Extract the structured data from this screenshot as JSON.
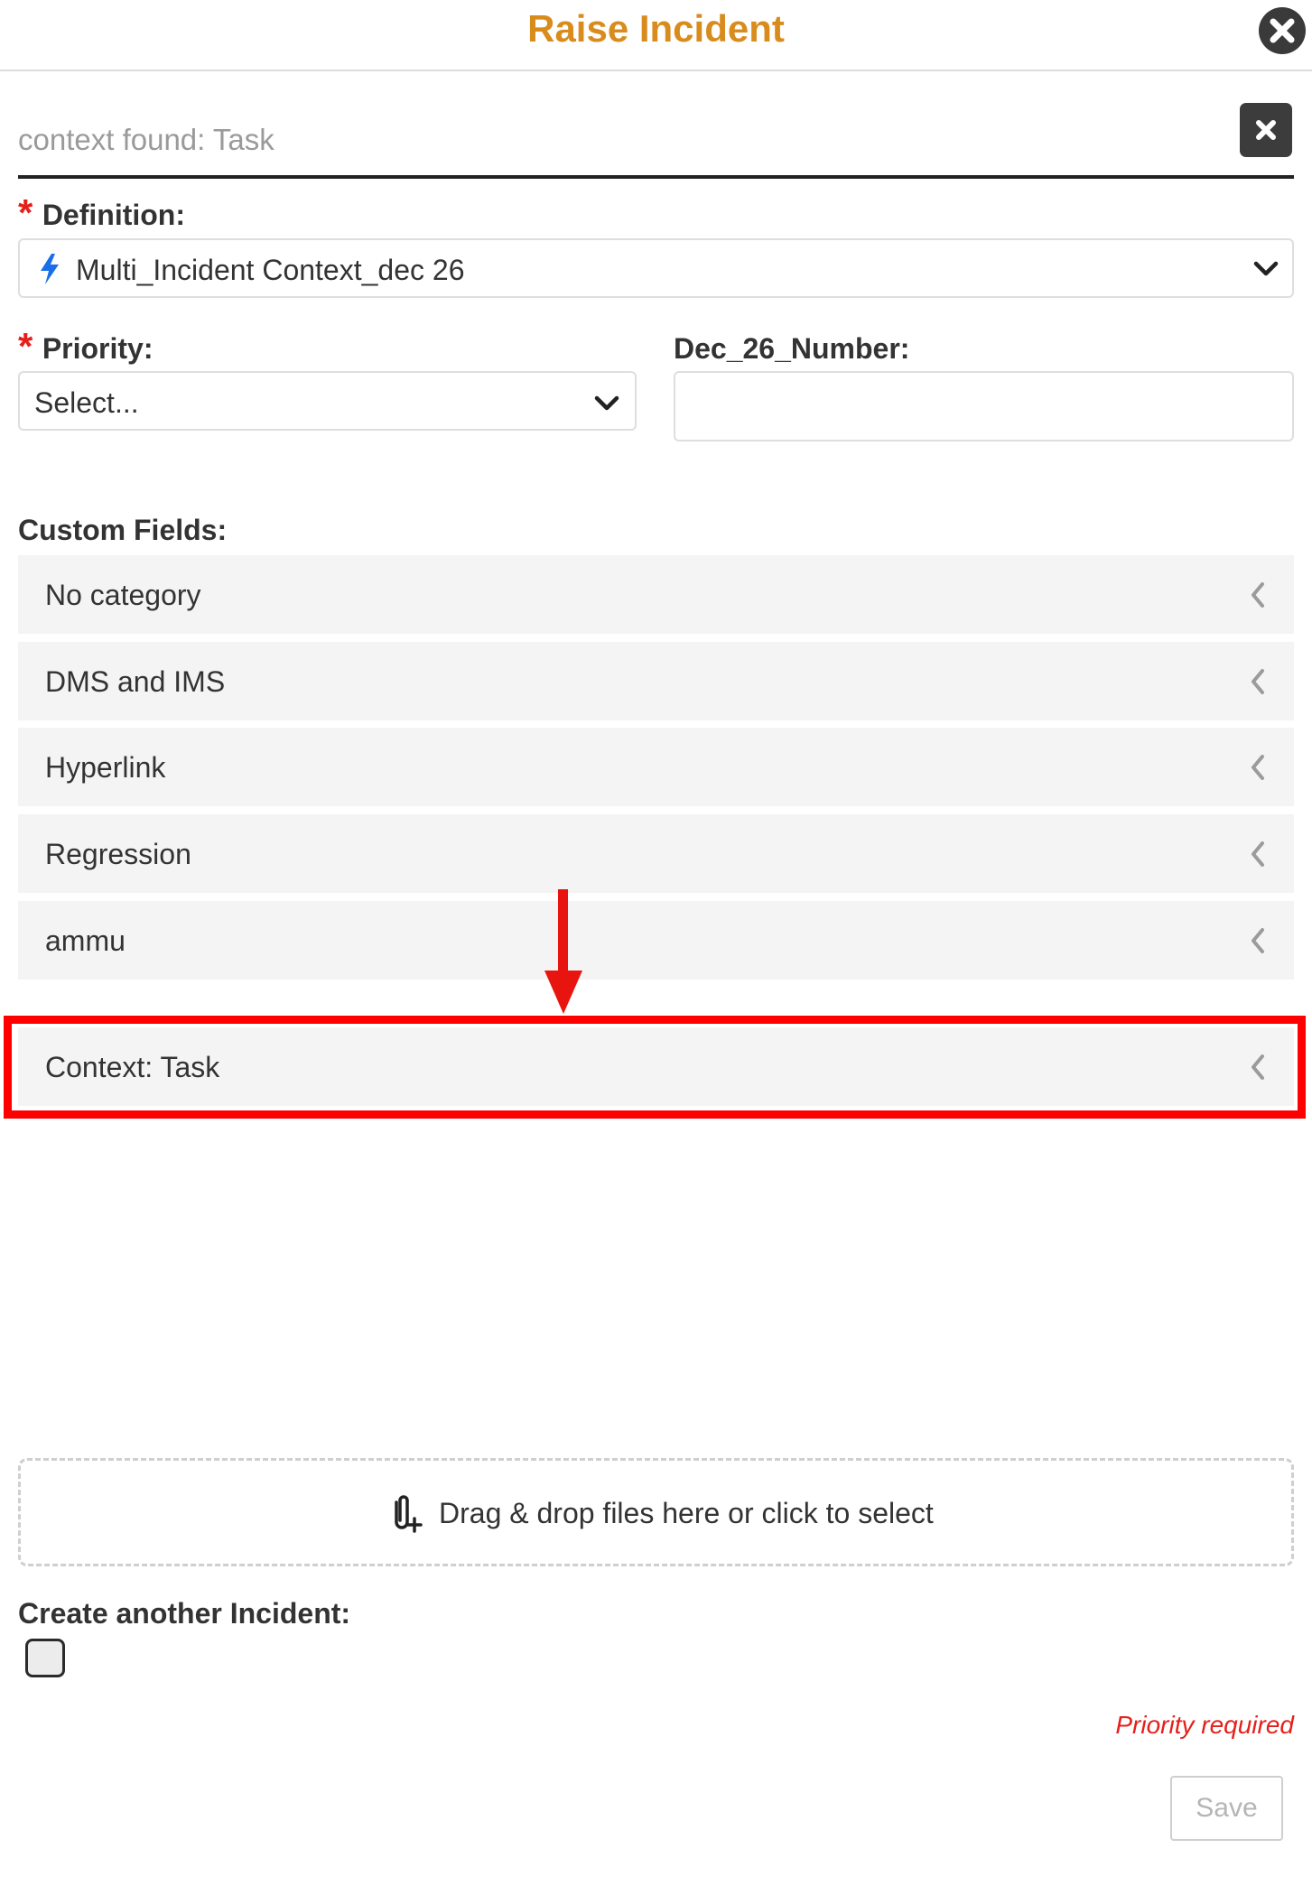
{
  "modal": {
    "title": "Raise Incident",
    "close_icon": "close-circle-icon",
    "title_color": "#d98c1e"
  },
  "context": {
    "text": "context found: Task",
    "clear_icon": "close-icon"
  },
  "definition": {
    "required_mark": "*",
    "label": "Definition:",
    "value": "Multi_Incident Context_dec 26",
    "value_icon": "lightning-bolt-icon",
    "dropdown_icon": "chevron-down-icon"
  },
  "priority": {
    "required_mark": "*",
    "label": "Priority:",
    "value": "Select...",
    "dropdown_icon": "chevron-down-icon"
  },
  "dec_number": {
    "label": "Dec_26_Number:",
    "value": ""
  },
  "custom_fields": {
    "label": "Custom Fields:",
    "categories": [
      {
        "label": "No category"
      },
      {
        "label": "DMS and IMS"
      },
      {
        "label": "Hyperlink"
      },
      {
        "label": "Regression"
      },
      {
        "label": "ammu"
      },
      {
        "label": "Context: Task"
      }
    ],
    "expand_icon": "chevron-left-icon"
  },
  "annotation": {
    "arrow_icon": "red-arrow-down-icon",
    "highlight_color": "#ff0000"
  },
  "attachments": {
    "text": "Drag & drop files here or click to select",
    "icon": "paperclip-plus-icon"
  },
  "create_another": {
    "label": "Create another Incident:",
    "checked": false
  },
  "validation": {
    "message": "Priority required",
    "color": "#e5201c"
  },
  "footer": {
    "save_label": "Save"
  }
}
